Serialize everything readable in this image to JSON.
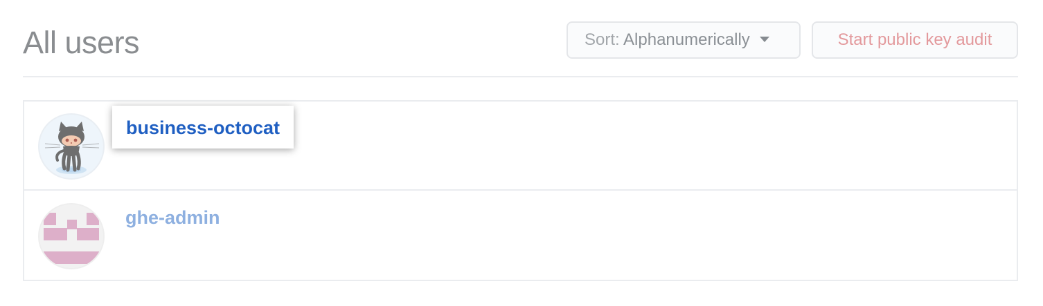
{
  "header": {
    "title": "All users",
    "sort_label": "Sort:",
    "sort_value": "Alphanumerically",
    "audit_button": "Start public key audit"
  },
  "users": [
    {
      "username": "business-octocat",
      "avatar": "octocat-avatar",
      "highlighted": true
    },
    {
      "username": "ghe-admin",
      "avatar": "identicon-avatar",
      "highlighted": false
    }
  ],
  "colors": {
    "link_highlighted": "#1f5fc2",
    "link_dimmed": "#8eb0e0",
    "audit_button_text": "#e3999c",
    "identicon": "#ddafc9"
  }
}
